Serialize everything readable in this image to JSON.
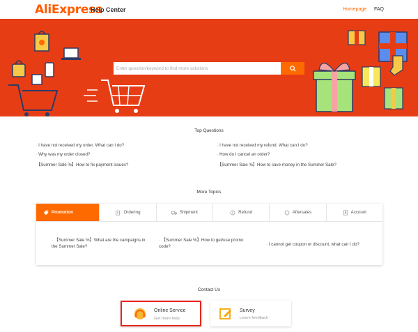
{
  "header": {
    "logo": "AliExpress",
    "subtitle": "Help Center",
    "nav": {
      "homepage": "Homepage",
      "faq": "FAQ"
    }
  },
  "search": {
    "placeholder": "Enter question/keyword to find more solutions",
    "icon": "search-icon"
  },
  "top_questions": {
    "title": "Top Questions",
    "left": [
      "I have not received my order. What can I do?",
      "Why was my order closed?",
      "【Summer Sale %】How to fix payment issues?"
    ],
    "right": [
      "I have not received my refund. What can I do?",
      "How do I cancel an order?",
      "【Summer Sale %】How to save money in the Summer Sale?"
    ]
  },
  "more_topics": {
    "title": "More Topics",
    "tabs": [
      {
        "label": "Promotion",
        "icon": "tag-icon",
        "active": true
      },
      {
        "label": "Ordering",
        "icon": "clipboard-icon",
        "active": false
      },
      {
        "label": "Shipment",
        "icon": "truck-icon",
        "active": false
      },
      {
        "label": "Refund",
        "icon": "refund-icon",
        "active": false
      },
      {
        "label": "Aftersales",
        "icon": "aftersales-icon",
        "active": false
      },
      {
        "label": "Account",
        "icon": "account-icon",
        "active": false
      }
    ],
    "items": [
      {
        "line1": "【Summer Sale %】What are the campaigns in",
        "line2": "the Summer Sale?"
      },
      {
        "line1": "【Summer Sale %】How to get/use promo",
        "line2": "code?"
      },
      {
        "line1": "I cannot get coupon or discount, what can I do?",
        "line2": ""
      }
    ]
  },
  "contact": {
    "title": "Contact Us",
    "cards": [
      {
        "title": "Online Service",
        "subtitle": "Get more help",
        "icon": "headset-icon"
      },
      {
        "title": "Survey",
        "subtitle": "Leave feedback",
        "icon": "edit-icon"
      }
    ]
  },
  "colors": {
    "brand": "#ff6a00",
    "banner": "#e73d15",
    "highlight": "#e8251b"
  }
}
